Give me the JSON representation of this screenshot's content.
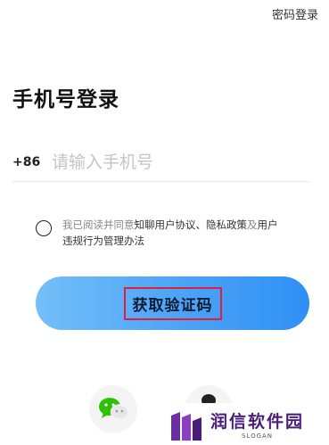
{
  "header": {
    "password_login": "密码登录"
  },
  "title": "手机号登录",
  "phone": {
    "country_code": "+86",
    "placeholder": "请输入手机号"
  },
  "agreement": {
    "prefix": "我已阅读并同意",
    "link1": "知聊用户协议、隐私政策",
    "joiner": "及",
    "link2_part1": "用户",
    "link2_part2": "违规行为管理办法"
  },
  "cta": {
    "label": "获取验证码"
  },
  "social": {
    "wechat_icon": "wechat-icon",
    "other_icon": "login-option-icon"
  },
  "watermark": {
    "title": "润信软件园",
    "slogan": "SLOGAN"
  },
  "colors": {
    "accent_start": "#74bff9",
    "accent_end": "#2f8ff3",
    "highlight_border": "#e0203a",
    "watermark_purple": "#4a1d7a"
  }
}
